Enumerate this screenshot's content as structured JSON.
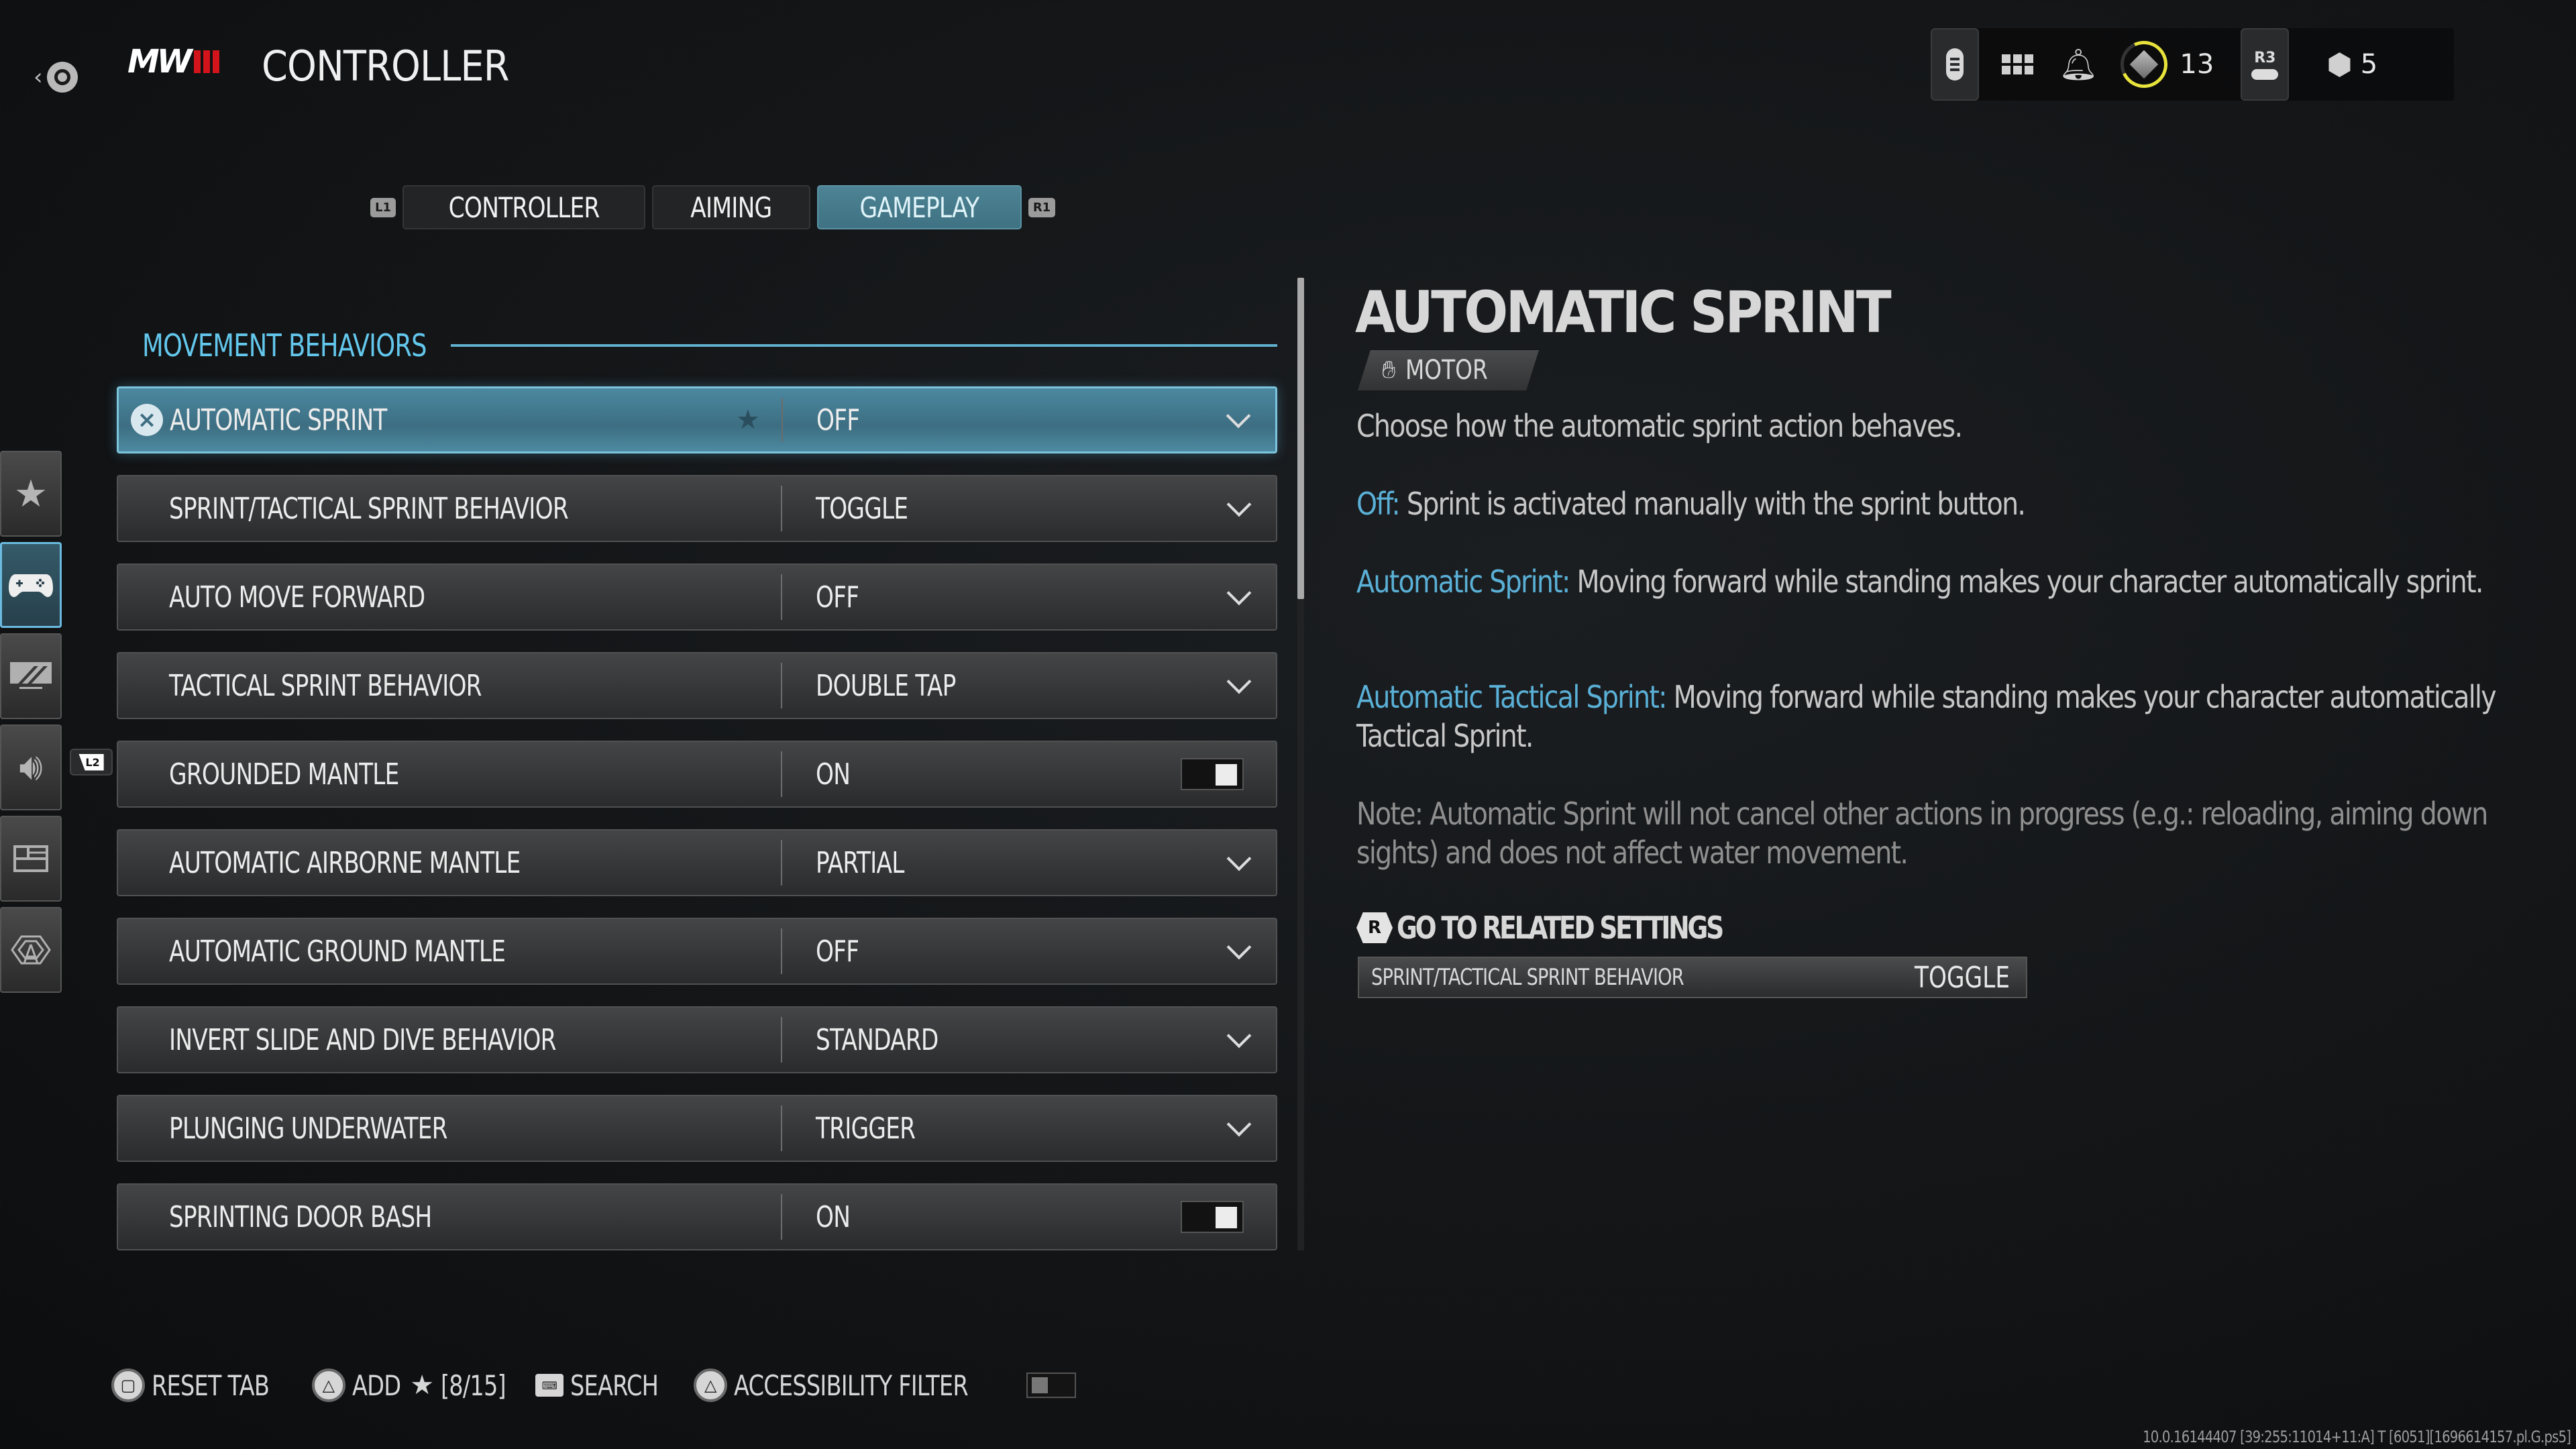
{
  "header": {
    "title": "CONTROLLER",
    "logo_text": "MW",
    "back_icon": "back-circle-icon",
    "topbar": {
      "rank_level": "13",
      "party_count": "5",
      "r3_label": "R3"
    }
  },
  "tabs": {
    "left_bumper": "L1",
    "right_bumper": "R1",
    "items": [
      {
        "label": "CONTROLLER",
        "active": false
      },
      {
        "label": "AIMING",
        "active": false
      },
      {
        "label": "GAMEPLAY",
        "active": true
      }
    ]
  },
  "rail": {
    "items": [
      {
        "icon": "star-icon",
        "name": "favorites",
        "active": false
      },
      {
        "icon": "gamepad-icon",
        "name": "controller",
        "active": true
      },
      {
        "icon": "display-icon",
        "name": "graphics",
        "active": false
      },
      {
        "icon": "speaker-icon",
        "name": "audio",
        "active": false
      },
      {
        "icon": "interface-icon",
        "name": "interface",
        "active": false
      },
      {
        "icon": "network-icon",
        "name": "account-network",
        "active": false
      }
    ],
    "l2_hint": "L2"
  },
  "section": {
    "title": "MOVEMENT BEHAVIORS"
  },
  "settings": [
    {
      "label": "AUTOMATIC SPRINT",
      "value": "OFF",
      "control": "dropdown",
      "selected": true
    },
    {
      "label": "SPRINT/TACTICAL SPRINT BEHAVIOR",
      "value": "TOGGLE",
      "control": "dropdown",
      "selected": false
    },
    {
      "label": "AUTO MOVE FORWARD",
      "value": "OFF",
      "control": "dropdown",
      "selected": false
    },
    {
      "label": "TACTICAL SPRINT BEHAVIOR",
      "value": "DOUBLE TAP",
      "control": "dropdown",
      "selected": false
    },
    {
      "label": "GROUNDED MANTLE",
      "value": "ON",
      "control": "toggle",
      "selected": false
    },
    {
      "label": "AUTOMATIC AIRBORNE MANTLE",
      "value": "PARTIAL",
      "control": "dropdown",
      "selected": false
    },
    {
      "label": "AUTOMATIC GROUND MANTLE",
      "value": "OFF",
      "control": "dropdown",
      "selected": false
    },
    {
      "label": "INVERT SLIDE AND DIVE BEHAVIOR",
      "value": "STANDARD",
      "control": "dropdown",
      "selected": false
    },
    {
      "label": "PLUNGING UNDERWATER",
      "value": "TRIGGER",
      "control": "dropdown",
      "selected": false
    },
    {
      "label": "SPRINTING DOOR BASH",
      "value": "ON",
      "control": "toggle",
      "selected": false
    }
  ],
  "scroll": {
    "visible_fraction": 0.33,
    "position": 0
  },
  "description": {
    "title": "AUTOMATIC SPRINT",
    "tag": "MOTOR",
    "summary": "Choose how the automatic sprint action behaves.",
    "options": [
      {
        "name": "Off:",
        "text": " Sprint is activated manually with the sprint button."
      },
      {
        "name": "Automatic Sprint:",
        "text": " Moving forward while standing makes your character automatically sprint."
      },
      {
        "name": "Automatic Tactical Sprint:",
        "text": "  Moving forward while standing makes your character automatically Tactical Sprint."
      }
    ],
    "note": "Note: Automatic Sprint will not cancel other actions in progress (e.g.: reloading, aiming down sights) and does not affect water movement.",
    "related_header": "GO TO RELATED SETTINGS",
    "related_button": "R",
    "related": {
      "label": "SPRINT/TACTICAL SPRINT BEHAVIOR",
      "value": "TOGGLE"
    }
  },
  "footer": {
    "reset": "RESET TAB",
    "add": "ADD",
    "add_count": "[8/15]",
    "search": "SEARCH",
    "accessibility": "ACCESSIBILITY FILTER",
    "accessibility_on": false
  },
  "build_info": "10.0.16144407 [39:255:11014+11:A] T [6051][1696614157.pl.G.ps5]",
  "colors": {
    "accent": "#63c7ec",
    "selected_row": "#3d6e82",
    "rank_ring": "#e8e33a",
    "logo_red": "#d3141b"
  }
}
